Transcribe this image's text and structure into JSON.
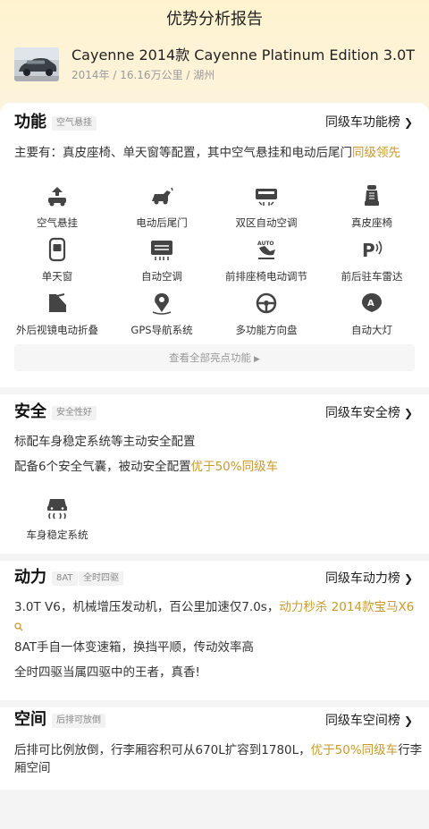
{
  "header": {
    "title": "优势分析报告",
    "car_name": "Cayenne 2014款 Cayenne Platinum Edition 3.0T",
    "car_meta": "2014年 / 16.16万公里 / 湖州"
  },
  "function": {
    "title": "功能",
    "tag": "空气悬挂",
    "rank_link": "同级车功能榜",
    "summary_prefix": "主要有：真皮座椅、单天窗等配置，其中空气悬挂和电动后尾门",
    "summary_highlight": "同级领先",
    "features": [
      {
        "label": "空气悬挂",
        "icon": "air-suspension-icon"
      },
      {
        "label": "电动后尾门",
        "icon": "power-tailgate-icon"
      },
      {
        "label": "双区自动空调",
        "icon": "dual-zone-ac-icon"
      },
      {
        "label": "真皮座椅",
        "icon": "leather-seat-icon"
      },
      {
        "label": "单天窗",
        "icon": "sunroof-icon"
      },
      {
        "label": "自动空调",
        "icon": "auto-ac-icon"
      },
      {
        "label": "前排座椅电动调节",
        "icon": "power-seat-icon"
      },
      {
        "label": "前后驻车雷达",
        "icon": "parking-radar-icon"
      },
      {
        "label": "外后视镜电动折叠",
        "icon": "mirror-fold-icon"
      },
      {
        "label": "GPS导航系统",
        "icon": "gps-navigation-icon"
      },
      {
        "label": "多功能方向盘",
        "icon": "steering-wheel-icon"
      },
      {
        "label": "自动大灯",
        "icon": "auto-headlight-icon"
      }
    ],
    "more_label": "查看全部亮点功能"
  },
  "safety": {
    "title": "安全",
    "tag": "安全性好",
    "rank_link": "同级车安全榜",
    "line1": "标配车身稳定系统等主动安全配置",
    "line2_prefix": "配备6个安全气囊，被动安全配置",
    "line2_highlight": "优于50%同级车",
    "feature_label": "车身稳定系统"
  },
  "power": {
    "title": "动力",
    "tag1": "8AT",
    "tag2": "全时四驱",
    "rank_link": "同级车动力榜",
    "line1_prefix": "3.0T V6，机械增压发动机，百公里加速仅7.0s，",
    "line1_highlight": "动力秒杀 2014款宝马X6",
    "line2": "8AT手自一体变速箱，换挡平顺，传动效率高",
    "line3": "全时四驱当属四驱中的王者，真香!"
  },
  "space": {
    "title": "空间",
    "tag": "后排可放倒",
    "rank_link": "同级车空间榜",
    "line1_prefix": "后排可比例放倒，行李厢容积可从670L扩容到1780L，",
    "line1_highlight": "优于50%同级车",
    "line1_suffix": "行李",
    "line2": "厢空间"
  },
  "colors": {
    "highlight": "#c99a2e",
    "header_bg": "#fff3cf"
  }
}
